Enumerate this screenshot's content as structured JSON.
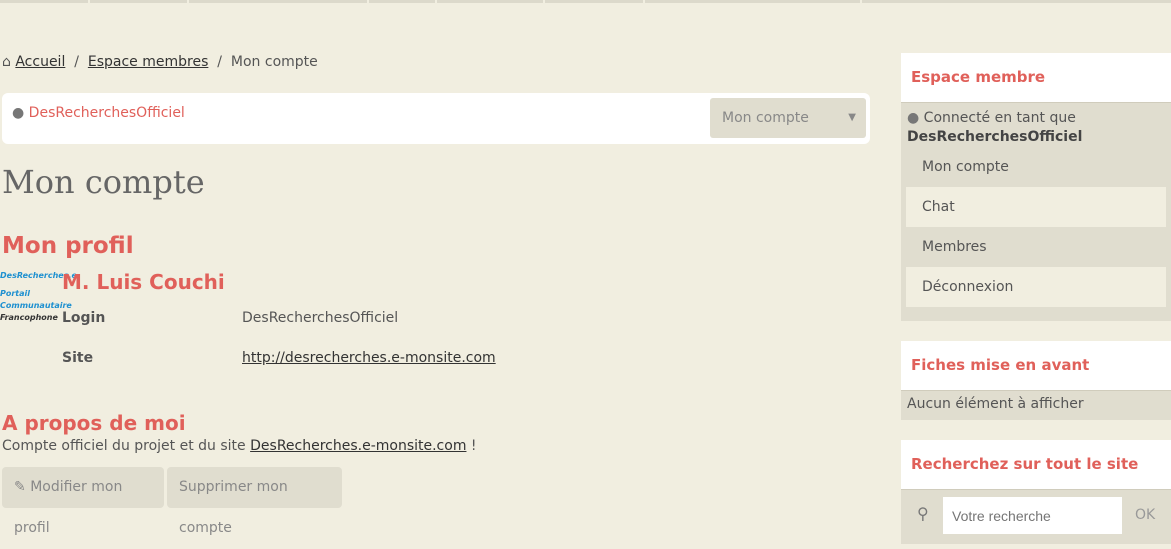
{
  "breadcrumb": {
    "home": "Accueil",
    "members": "Espace membres",
    "current": "Mon compte"
  },
  "userbar": {
    "username": "DesRecherchesOfficiel",
    "select_value": "Mon compte"
  },
  "page_title": "Mon compte",
  "profile": {
    "heading": "Mon profil",
    "logo_lines": [
      "DesRecherches.e",
      "Portail Communautaire",
      "Francophone"
    ],
    "name": "M. Luis Couchi",
    "login_label": "Login",
    "login_value": "DesRecherchesOfficiel",
    "site_label": "Site",
    "site_value": "http://desrecherches.e-monsite.com"
  },
  "about": {
    "heading": "A propos de moi",
    "text": "Compte officiel du projet et du site ",
    "link": "DesRecherches.e-monsite.com",
    "suffix": " !"
  },
  "buttons": {
    "edit": "Modifier mon profil",
    "delete": "Supprimer mon compte"
  },
  "sidebar": {
    "member": {
      "title": "Espace membre",
      "connected": "Connecté en tant que",
      "user": "DesRecherchesOfficiel",
      "items": [
        "Mon compte",
        "Chat",
        "Membres",
        "Déconnexion"
      ]
    },
    "featured": {
      "title": "Fiches mise en avant",
      "empty": "Aucun élément à afficher"
    },
    "search": {
      "title": "Recherchez sur tout le site",
      "placeholder": "Votre recherche",
      "ok": "OK"
    }
  },
  "colors": {
    "accent": "#e0605a",
    "background": "#f1eee0",
    "panel": "#e0ddcf"
  }
}
